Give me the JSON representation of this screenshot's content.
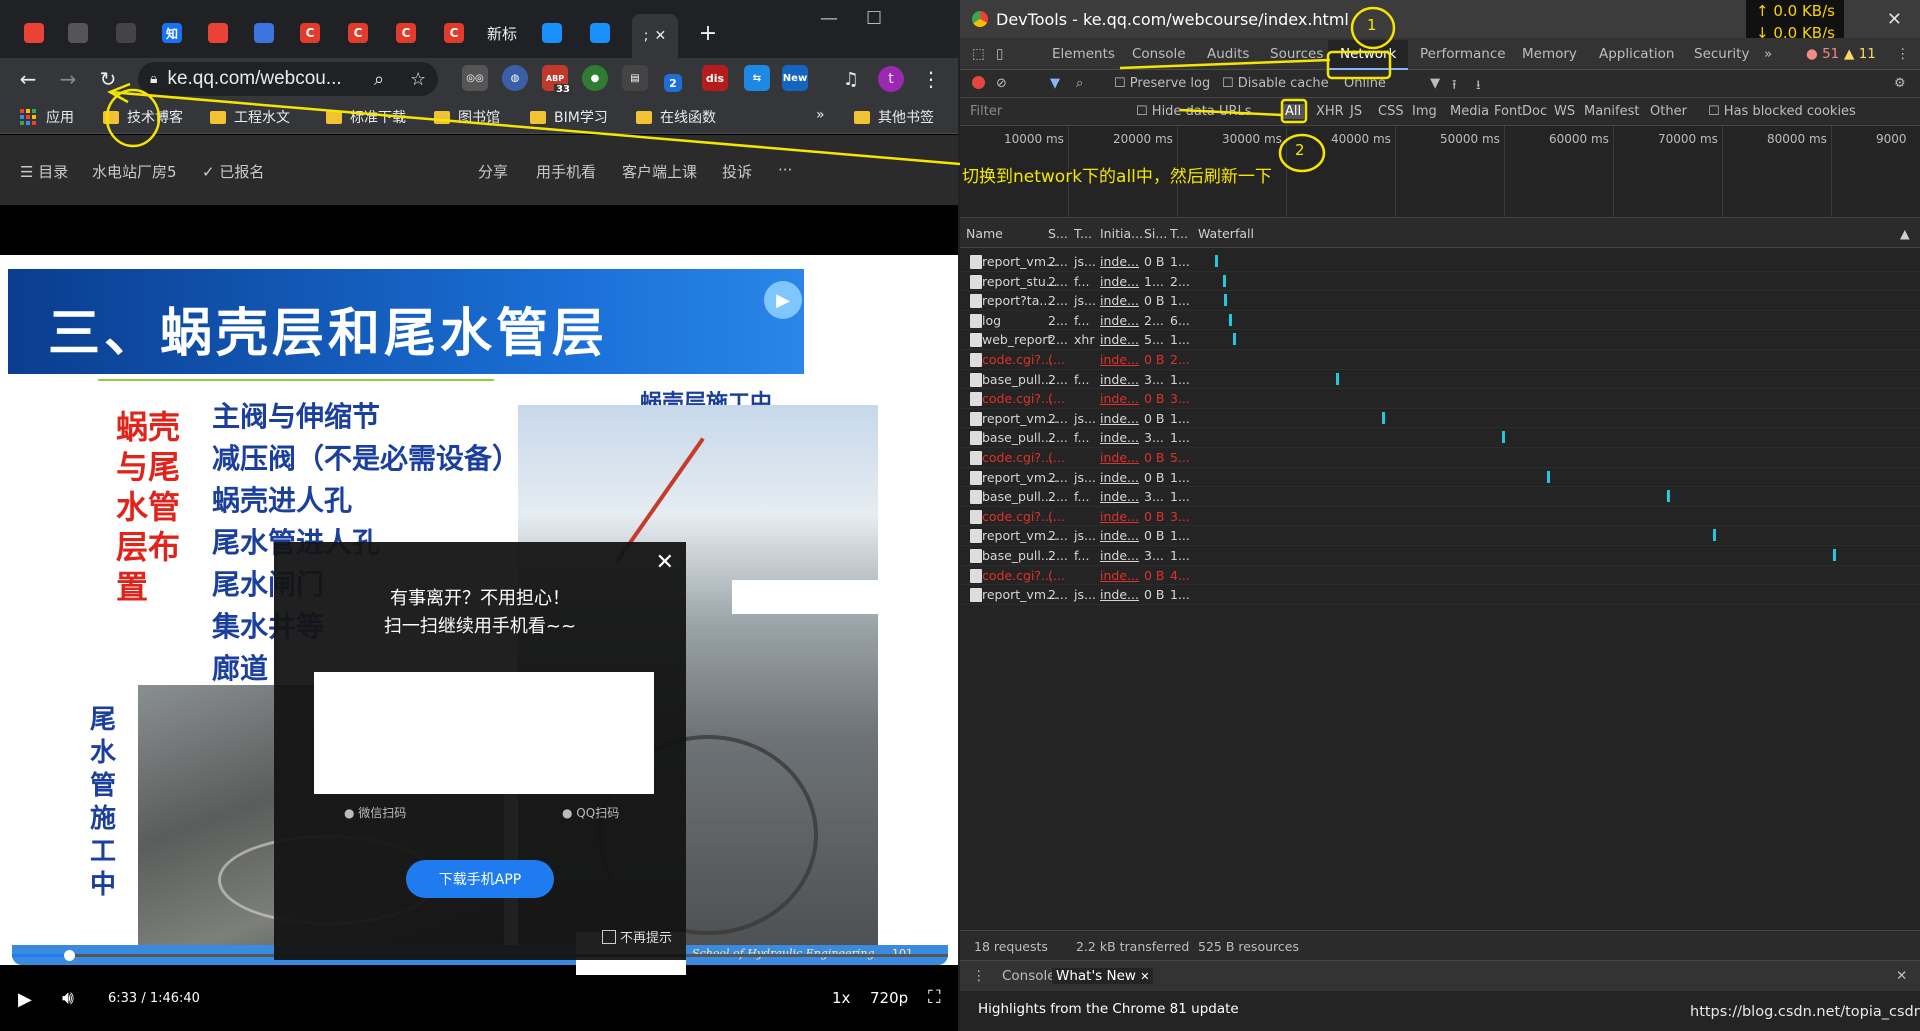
{
  "browser": {
    "tabs": [
      {
        "label": "",
        "icon": "google-icon",
        "color": "#ea4335"
      },
      {
        "label": "",
        "icon": "extension-icon",
        "color": "#555"
      },
      {
        "label": "",
        "icon": "disabled-icon",
        "color": "#444"
      },
      {
        "label": "知",
        "icon": "zhihu-icon",
        "color": "#1772f6"
      },
      {
        "label": "",
        "icon": "google-icon",
        "color": "#ea4335"
      },
      {
        "label": "",
        "icon": "pen-icon",
        "color": "#3b73e0"
      },
      {
        "label": "C",
        "icon": "csdn-icon",
        "color": "#e03b2b"
      },
      {
        "label": "C",
        "icon": "csdn-icon",
        "color": "#e03b2b"
      },
      {
        "label": "C",
        "icon": "csdn-icon",
        "color": "#e03b2b"
      },
      {
        "label": "C",
        "icon": "csdn-icon",
        "color": "#e03b2b"
      },
      {
        "label": "新标",
        "icon": "",
        "color": ""
      },
      {
        "label": "",
        "icon": "diamond-icon",
        "color": "#1a8fff"
      },
      {
        "label": "",
        "icon": "diamond-icon",
        "color": "#1a8fff"
      },
      {
        "label": ";",
        "icon": "",
        "color": ""
      }
    ],
    "active_tab_close": "✕",
    "new_tab": "+",
    "url": "ke.qq.com/webcou...",
    "ext_labels": {
      "abp_count": "33",
      "dis": "dis",
      "new": "New",
      "two": "2",
      "avatar": "t"
    },
    "bookmarks": [
      "应用",
      "技术博客",
      "工程水文",
      "标准下载",
      "图书馆",
      "BIM学习",
      "在线函数"
    ],
    "bookmarks_more": "»",
    "other_bookmarks": "其他书签"
  },
  "page": {
    "bar": {
      "menu": "☰ 目录",
      "course": "水电站厂房5",
      "enrolled": "✓ 已报名",
      "share": "分享",
      "phone": "用手机看",
      "client": "客户端上课",
      "complain": "投诉",
      "more": "···"
    },
    "slide": {
      "title": "三、蜗壳层和尾水管层",
      "subtitle_right": "蜗壳层施工中",
      "red_vertical": [
        "蜗壳",
        "与尾",
        "水管",
        "层布",
        "置"
      ],
      "items": [
        "主阀与伸缩节",
        "减压阀（不是必需设备）",
        "蜗壳进人孔",
        "尾水管进人孔",
        "尾水闸门",
        "集水井等",
        "廊道"
      ],
      "blue_vertical": [
        "尾",
        "水",
        "管",
        "施",
        "工",
        "中"
      ],
      "footer": "School of Hydraulic Engineering",
      "page_no": "101"
    },
    "modal": {
      "close": "✕",
      "line1": "有事离开？不用担心！",
      "line2": "扫一扫继续用手机看~~",
      "wechat": "微信扫码",
      "qq": "QQ扫码",
      "download": "下载手机APP",
      "no_show": "不再提示"
    },
    "player": {
      "time": "6:33 / 1:46:40",
      "speed": "1x",
      "quality": "720p",
      "progress": 0.061
    }
  },
  "devtools": {
    "title": "DevTools - ke.qq.com/webcourse/index.html",
    "netspeed_up": "↑ 0.0 KB/s",
    "netspeed_down": "↓ 0.0 KB/s",
    "tabs": [
      "Elements",
      "Console",
      "Audits",
      "Sources",
      "Network",
      "Performance",
      "Memory",
      "Application",
      "Security",
      "»"
    ],
    "errors": "51",
    "warnings": "11",
    "controls": {
      "preserve": "Preserve log",
      "disable": "Disable cache",
      "online": "Online"
    },
    "filter_placeholder": "Filter",
    "hide_data": "Hide data URLs",
    "types": [
      "All",
      "XHR",
      "JS",
      "CSS",
      "Img",
      "Media",
      "Font",
      "Doc",
      "WS",
      "Manifest",
      "Other"
    ],
    "blocked": "Has blocked cookies",
    "ticks": [
      "10000 ms",
      "20000 ms",
      "30000 ms",
      "40000 ms",
      "50000 ms",
      "60000 ms",
      "70000 ms",
      "80000 ms",
      "9000"
    ],
    "columns": [
      "Name",
      "S...",
      "T...",
      "Initia...",
      "Si...",
      "T...",
      "Waterfall"
    ],
    "rows": [
      {
        "name": "report_vm...",
        "s": "2...",
        "t": "js...",
        "init": "inde...",
        "size": "0 B",
        "time": "1...",
        "err": false,
        "bar": 0.4
      },
      {
        "name": "report_stu...",
        "s": "2...",
        "t": "f...",
        "init": "inde...",
        "size": "1...",
        "time": "2...",
        "err": false,
        "bar": 1.6
      },
      {
        "name": "report?ta...",
        "s": "2...",
        "t": "js...",
        "init": "inde...",
        "size": "0 B",
        "time": "1...",
        "err": false,
        "bar": 1.8
      },
      {
        "name": "log",
        "s": "2...",
        "t": "f...",
        "init": "inde...",
        "size": "2...",
        "time": "6...",
        "err": false,
        "bar": 2.5
      },
      {
        "name": "web_report",
        "s": "2...",
        "t": "xhr",
        "init": "inde...",
        "size": "5...",
        "time": "1...",
        "err": false,
        "bar": 3.0
      },
      {
        "name": "code.cgi?...",
        "s": "(...",
        "t": "",
        "init": "inde...",
        "size": "0 B",
        "time": "2...",
        "err": true,
        "bar": null
      },
      {
        "name": "base_pull...",
        "s": "2...",
        "t": "f...",
        "init": "inde...",
        "size": "3...",
        "time": "1...",
        "err": false,
        "bar": 18.0
      },
      {
        "name": "code.cgi?...",
        "s": "(...",
        "t": "",
        "init": "inde...",
        "size": "0 B",
        "time": "3...",
        "err": true,
        "bar": null
      },
      {
        "name": "report_vm...",
        "s": "2...",
        "t": "js...",
        "init": "inde...",
        "size": "0 B",
        "time": "1...",
        "err": false,
        "bar": 24.6
      },
      {
        "name": "base_pull...",
        "s": "2...",
        "t": "f...",
        "init": "inde...",
        "size": "3...",
        "time": "1...",
        "err": false,
        "bar": 42.0
      },
      {
        "name": "code.cgi?...",
        "s": "(...",
        "t": "",
        "init": "inde...",
        "size": "0 B",
        "time": "5...",
        "err": true,
        "bar": null
      },
      {
        "name": "report_vm...",
        "s": "2...",
        "t": "js...",
        "init": "inde...",
        "size": "0 B",
        "time": "1...",
        "err": false,
        "bar": 48.6
      },
      {
        "name": "base_pull...",
        "s": "2...",
        "t": "f...",
        "init": "inde...",
        "size": "3...",
        "time": "1...",
        "err": false,
        "bar": 66.0
      },
      {
        "name": "code.cgi?...",
        "s": "(...",
        "t": "",
        "init": "inde...",
        "size": "0 B",
        "time": "3...",
        "err": true,
        "bar": null
      },
      {
        "name": "report_vm...",
        "s": "2...",
        "t": "js...",
        "init": "inde...",
        "size": "0 B",
        "time": "1...",
        "err": false,
        "bar": 72.6
      },
      {
        "name": "base_pull...",
        "s": "2...",
        "t": "f...",
        "init": "inde...",
        "size": "3...",
        "time": "1...",
        "err": false,
        "bar": 90.0
      },
      {
        "name": "code.cgi?...",
        "s": "(...",
        "t": "",
        "init": "inde...",
        "size": "0 B",
        "time": "4...",
        "err": true,
        "bar": null
      },
      {
        "name": "report_vm...",
        "s": "2...",
        "t": "js...",
        "init": "inde...",
        "size": "0 B",
        "time": "1...",
        "err": false,
        "bar": null
      }
    ],
    "status": {
      "requests": "18 requests",
      "transferred": "2.2 kB transferred",
      "resources": "525 B resources"
    },
    "drawer": {
      "console": "Console",
      "whatsnew": "What's New",
      "highlights": "Highlights from the Chrome 81 update"
    }
  },
  "annotation": {
    "text": "切换到network下的all中，然后刷新一下",
    "n1": "1",
    "n2": "2",
    "color": "#f5e600"
  },
  "watermark": "https://blog.csdn.net/topia_csdn"
}
